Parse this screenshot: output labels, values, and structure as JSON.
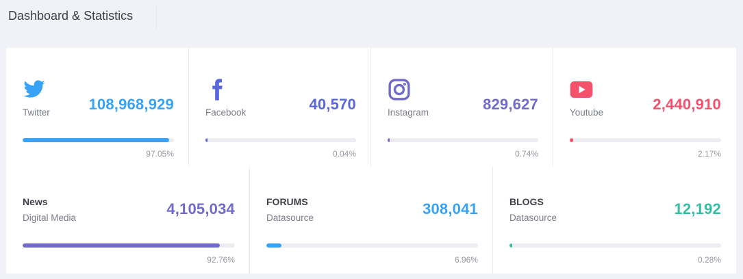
{
  "header": {
    "title": "Dashboard & Statistics"
  },
  "colors": {
    "twitter": "#36a3f7",
    "facebook": "#5867dd",
    "instagram": "#716aca",
    "youtube": "#f4516c",
    "news": "#716aca",
    "forums": "#36a3f7",
    "blogs": "#34bfa3"
  },
  "cards": [
    {
      "icon": "twitter-icon",
      "label": "Twitter",
      "value": "108,968,929",
      "percent_text": "97.05%",
      "progress": 97.05
    },
    {
      "icon": "facebook-icon",
      "label": "Facebook",
      "value": "40,570",
      "percent_text": "0.04%",
      "progress": 0.04
    },
    {
      "icon": "instagram-icon",
      "label": "Instagram",
      "value": "829,627",
      "percent_text": "0.74%",
      "progress": 0.74
    },
    {
      "icon": "youtube-icon",
      "label": "Youtube",
      "value": "2,440,910",
      "percent_text": "2.17%",
      "progress": 2.17
    },
    {
      "title": "News",
      "subtitle": "Digital Media",
      "value": "4,105,034",
      "percent_text": "92.76%",
      "progress": 92.76
    },
    {
      "title": "FORUMS",
      "subtitle": "Datasource",
      "value": "308,041",
      "percent_text": "6.96%",
      "progress": 6.96
    },
    {
      "title": "BLOGS",
      "subtitle": "Datasource",
      "value": "12,192",
      "percent_text": "0.28%",
      "progress": 0.28
    }
  ]
}
